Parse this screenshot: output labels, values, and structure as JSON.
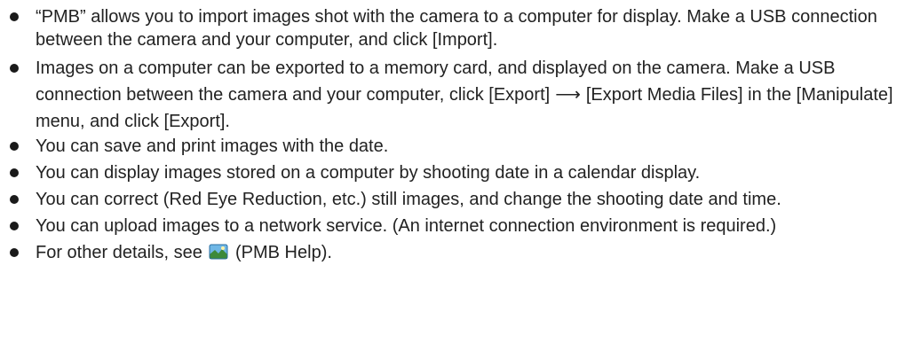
{
  "items": [
    {
      "text": "“PMB” allows you to import images shot with the camera to a computer for display. Make a USB connection between the camera and your computer, and click [Import]."
    },
    {
      "text_before_arrow": "Images on a computer can be exported to a memory card, and displayed on the camera. Make a USB connection between the camera and your computer, click [Export]",
      "arrow": "⟶",
      "text_after_arrow": "[Export Media Files] in the [Manipulate] menu, and click [Export]."
    },
    {
      "text": "You can save and print images with the date."
    },
    {
      "text": "You can display images stored on a computer by shooting date in a calendar display."
    },
    {
      "text": "You can correct (Red Eye Reduction, etc.) still images, and change the shooting date and time."
    },
    {
      "text": "You can upload images to a network service. (An internet connection environment is required.)"
    },
    {
      "text_before_icon": "For other details, see",
      "icon": "pmb-help-icon",
      "text_after_icon": "(PMB Help)."
    }
  ],
  "colors": {
    "text": "#222222",
    "bullet": "#1a1a1a",
    "icon_sky": "#6fb7e6",
    "icon_ground": "#3d8a3a"
  }
}
